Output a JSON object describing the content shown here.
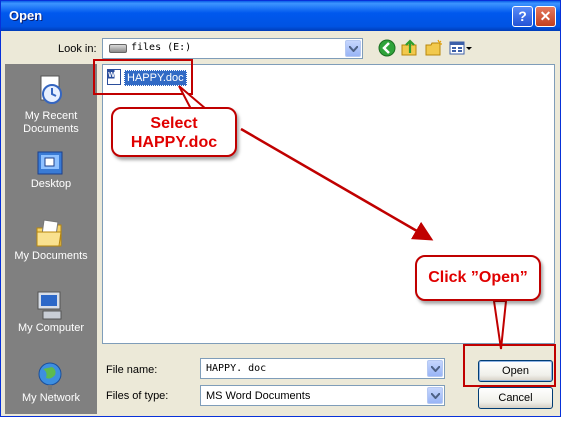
{
  "window": {
    "title": "Open"
  },
  "titlebar": {
    "help_glyph": "?",
    "close_glyph": "✕"
  },
  "lookin": {
    "label": "Look in:",
    "value": "files (E:)"
  },
  "places": [
    {
      "label": "My Recent Documents",
      "icon": "recent-documents-icon"
    },
    {
      "label": "Desktop",
      "icon": "desktop-icon"
    },
    {
      "label": "My Documents",
      "icon": "my-documents-icon"
    },
    {
      "label": "My Computer",
      "icon": "my-computer-icon"
    },
    {
      "label": "My Network",
      "icon": "my-network-icon"
    }
  ],
  "files": [
    {
      "name": "HAPPY.doc",
      "selected": true
    }
  ],
  "filename": {
    "label": "File name:",
    "value": "HAPPY. doc"
  },
  "filetype": {
    "label": "Files of type:",
    "value": "MS Word Documents"
  },
  "buttons": {
    "open": "Open",
    "cancel": "Cancel"
  },
  "annotations": {
    "select_line1": "Select",
    "select_line2": "HAPPY.doc",
    "click_open": "Click ”Open”"
  },
  "colors": {
    "titlebar": "#0058EE",
    "callout": "#C00000",
    "selection": "#316AC5",
    "dialog_bg": "#ECE9D8"
  }
}
